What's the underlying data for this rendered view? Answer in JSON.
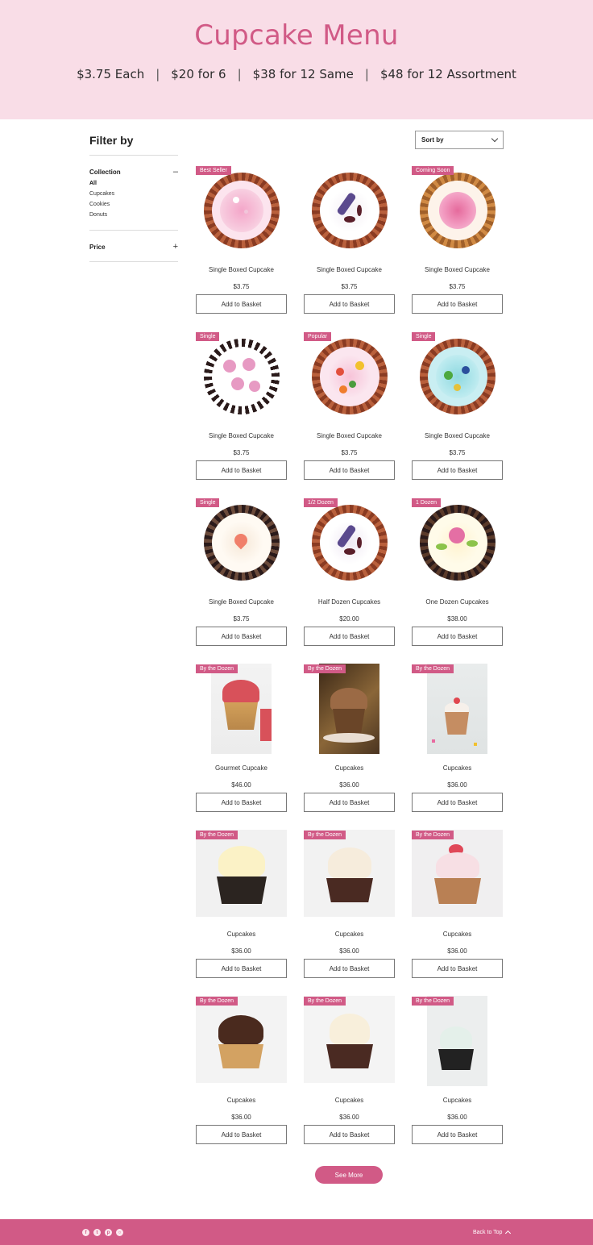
{
  "header": {
    "title": "Cupcake Menu",
    "pricing": [
      "$3.75 Each",
      "$20 for 6",
      "$38 for 12 Same",
      "$48 for 12 Assortment"
    ],
    "separator": "|"
  },
  "sidebar": {
    "title": "Filter by",
    "collection": {
      "label": "Collection",
      "toggle": "–",
      "items": [
        "All",
        "Cupcakes",
        "Cookies",
        "Donuts"
      ]
    },
    "price": {
      "label": "Price",
      "toggle": "+"
    }
  },
  "sort": {
    "label": "Sort by"
  },
  "products": [
    {
      "badge": "Best Seller",
      "name": "Single Boxed Cupcake",
      "price": "$3.75",
      "button": "Add to Basket"
    },
    {
      "badge": "",
      "name": "Single Boxed Cupcake",
      "price": "$3.75",
      "button": "Add to Basket"
    },
    {
      "badge": "Coming Soon",
      "name": "Single Boxed Cupcake",
      "price": "$3.75",
      "button": "Add to Basket"
    },
    {
      "badge": "Single",
      "name": "Single Boxed Cupcake",
      "price": "$3.75",
      "button": "Add to Basket"
    },
    {
      "badge": "Popular",
      "name": "Single Boxed Cupcake",
      "price": "$3.75",
      "button": "Add to Basket"
    },
    {
      "badge": "Single",
      "name": "Single Boxed Cupcake",
      "price": "$3.75",
      "button": "Add to Basket"
    },
    {
      "badge": "Single",
      "name": "Single Boxed Cupcake",
      "price": "$3.75",
      "button": "Add to Basket"
    },
    {
      "badge": "1/2 Dozen",
      "name": "Half Dozen Cupcakes",
      "price": "$20.00",
      "button": "Add to Basket"
    },
    {
      "badge": "1 Dozen",
      "name": "One Dozen Cupcakes",
      "price": "$38.00",
      "button": "Add to Basket"
    },
    {
      "badge": "By the Dozen",
      "name": "Gourmet Cupcake",
      "price": "$46.00",
      "button": "Add to Basket"
    },
    {
      "badge": "By the Dozen",
      "name": "Cupcakes",
      "price": "$36.00",
      "button": "Add to Basket"
    },
    {
      "badge": "By the Dozen",
      "name": "Cupcakes",
      "price": "$36.00",
      "button": "Add to Basket"
    },
    {
      "badge": "By the Dozen",
      "name": "Cupcakes",
      "price": "$36.00",
      "button": "Add to Basket"
    },
    {
      "badge": "By the Dozen",
      "name": "Cupcakes",
      "price": "$36.00",
      "button": "Add to Basket"
    },
    {
      "badge": "By the Dozen",
      "name": "Cupcakes",
      "price": "$36.00",
      "button": "Add to Basket"
    },
    {
      "badge": "By the Dozen",
      "name": "Cupcakes",
      "price": "$36.00",
      "button": "Add to Basket"
    },
    {
      "badge": "By the Dozen",
      "name": "Cupcakes",
      "price": "$36.00",
      "button": "Add to Basket"
    },
    {
      "badge": "By the Dozen",
      "name": "Cupcakes",
      "price": "$36.00",
      "button": "Add to Basket"
    }
  ],
  "see_more": "See More",
  "footer": {
    "socials": [
      "facebook-icon",
      "twitter-icon",
      "pinterest-icon",
      "instagram-icon"
    ],
    "back_to_top": "Back to Top"
  },
  "colors": {
    "accent": "#d15a86",
    "header_bg": "#f9dde7"
  }
}
